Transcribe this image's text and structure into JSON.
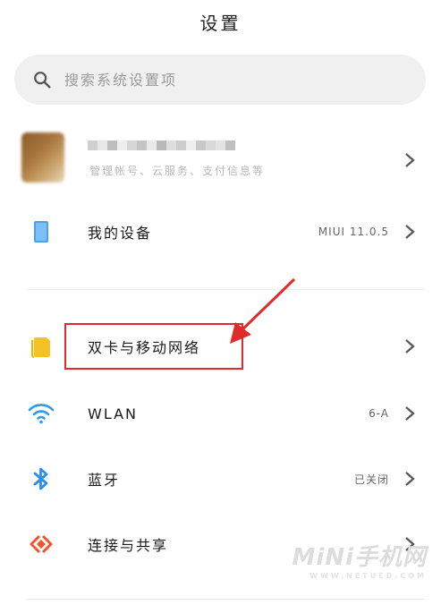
{
  "header": {
    "title": "设置"
  },
  "search": {
    "placeholder": "搜索系统设置项"
  },
  "account": {
    "subtitle": "管理帐号、云服务、支付信息等"
  },
  "items": [
    {
      "label": "我的设备",
      "value": "MIUI 11.0.5",
      "icon": "device-icon"
    },
    {
      "label": "双卡与移动网络",
      "value": "",
      "icon": "sim-card-icon"
    },
    {
      "label": "WLAN",
      "value": "6-A",
      "icon": "wifi-icon"
    },
    {
      "label": "蓝牙",
      "value": "已关闭",
      "icon": "bluetooth-icon"
    },
    {
      "label": "连接与共享",
      "value": "",
      "icon": "share-icon"
    }
  ],
  "watermark": {
    "brand": "MiNi手机网",
    "site": "WWW.NETUED.COM"
  },
  "colors": {
    "accent_red": "#e02b2b",
    "device_blue": "#4aa3e8",
    "sim_yellow": "#f6c027",
    "wifi_blue": "#2e9bf0",
    "share_orange": "#f2542d"
  }
}
